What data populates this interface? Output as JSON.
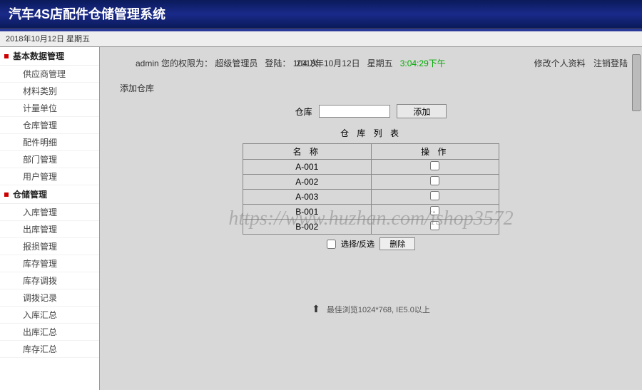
{
  "header": {
    "title": "汽车4S店配件仓储管理系统"
  },
  "datebar": {
    "text": "2018年10月12日 星期五"
  },
  "sidebar": {
    "groups": [
      {
        "title": "基本数据管理",
        "items": [
          "供应商管理",
          "材料类别",
          "计量单位",
          "仓库管理",
          "配件明细",
          "部门管理",
          "用户管理"
        ]
      },
      {
        "title": "仓储管理",
        "items": [
          "入库管理",
          "出库管理",
          "报损管理",
          "库存管理",
          "库存调拨",
          "调拨记录",
          "入库汇总",
          "出库汇总",
          "库存汇总"
        ]
      }
    ]
  },
  "info": {
    "user": "admin",
    "role_label": "您的权限为：",
    "role": "超级管理员",
    "login_label": "登陆：",
    "login_count": "104 次",
    "date": "2018年10月12日",
    "weekday": "星期五",
    "time": "3:04:29下午",
    "link_profile": "修改个人资料",
    "link_logout": "注销登陆"
  },
  "section": {
    "title": "添加仓库",
    "field_label": "仓库",
    "add_btn": "添加",
    "list_title": "仓 库 列 表",
    "col_name": "名 称",
    "col_op": "操 作",
    "rows": [
      "A-001",
      "A-002",
      "A-003",
      "B-001",
      "B-002"
    ],
    "select_all": "选择/反选",
    "delete_btn": "删除"
  },
  "footer": {
    "text": "最佳浏览1024*768, IE5.0以上"
  },
  "watermark": "https://www.huzhan.com/ishop3572"
}
